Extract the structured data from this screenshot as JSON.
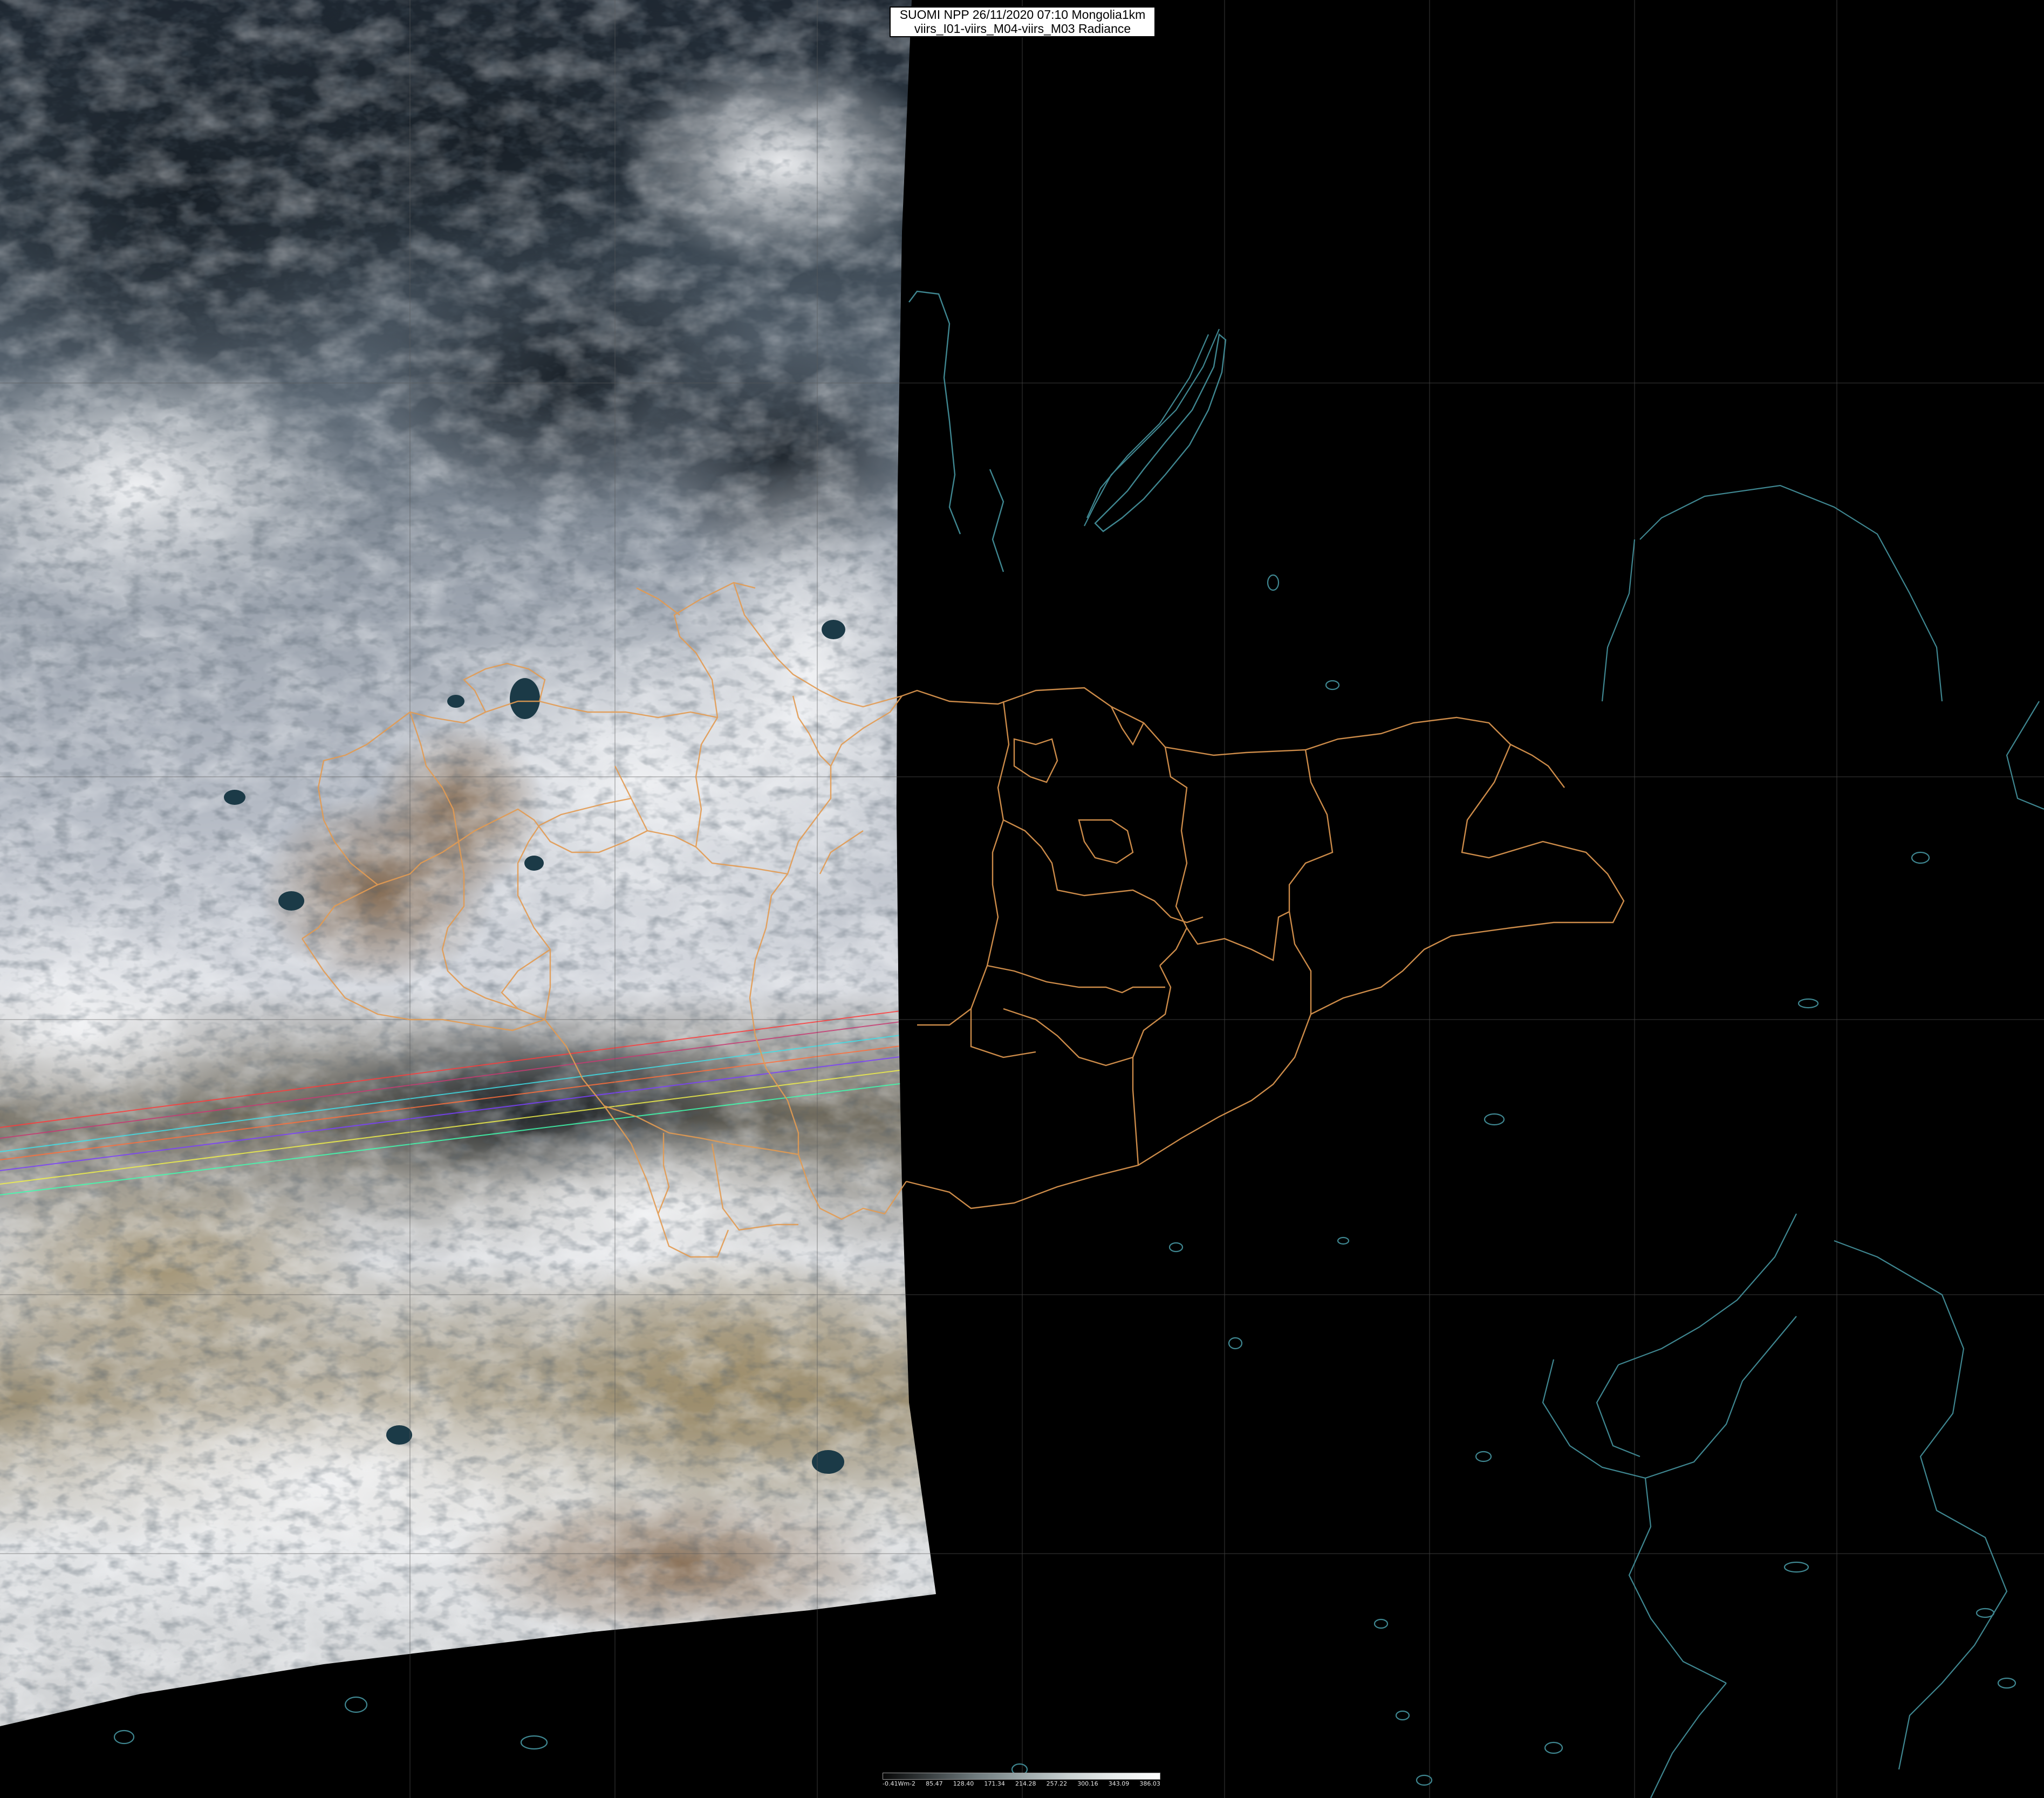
{
  "header": {
    "title_line1": "SUOMI NPP 26/11/2020 07:10 Mongolia1km",
    "title_line2": "viirs_I01-viirs_M04-viirs_M03 Radiance"
  },
  "legend": {
    "ticks": [
      "-0.41Wm-2",
      "85.47",
      "128.40",
      "171.34",
      "214.28",
      "257.22",
      "300.16",
      "343.09",
      "386.03"
    ]
  },
  "colors": {
    "background": "#000000",
    "border_lines": "#e39b52",
    "coastlines": "#3f8791",
    "graticule": "#5a5a5a"
  }
}
